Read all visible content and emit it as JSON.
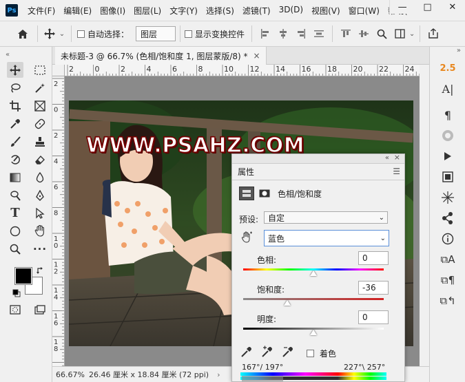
{
  "app": {
    "logo": "Ps"
  },
  "menu": [
    "文件(F)",
    "编辑(E)",
    "图像(I)",
    "图层(L)",
    "文字(Y)",
    "选择(S)",
    "滤镜(T)",
    "3D(D)",
    "视图(V)",
    "窗口(W)",
    "帮助("
  ],
  "window_controls": {
    "minimize": "—",
    "restore": "□",
    "close": "✕"
  },
  "options": {
    "auto_select_label": "自动选择：",
    "layer_dropdown": "图层",
    "show_transform_label": "显示变换控件"
  },
  "document": {
    "tab_title": "未标题-3 @ 66.7% (色相/饱和度 1, 图层蒙版/8) *",
    "tab_close": "×",
    "ruler_top": [
      "2",
      "0",
      "2",
      "4",
      "6",
      "8",
      "10",
      "12",
      "14",
      "16",
      "18",
      "20",
      "22",
      "24",
      "26"
    ],
    "ruler_left": [
      "2",
      "0",
      "2",
      "4",
      "6",
      "8",
      "1\n0",
      "1\n2",
      "1\n4",
      "1\n6",
      "1\n8"
    ],
    "watermark": "WWW.PSAHZ.COM"
  },
  "status": {
    "zoom": "66.67%",
    "size": "26.46 厘米 x 18.84 厘米 (72 ppi)"
  },
  "right_dock": {
    "value_label": "2.5"
  },
  "properties": {
    "title": "属性",
    "adjustment_name": "色相/饱和度",
    "preset_label": "预设:",
    "preset_value": "自定",
    "channel_value": "蓝色",
    "hue_label": "色相:",
    "hue_value": "0",
    "saturation_label": "饱和度:",
    "saturation_value": "-36",
    "lightness_label": "明度:",
    "lightness_value": "0",
    "colorize_label": "着色",
    "range_left": "167°/ 197°",
    "range_right": "227°\\ 257°"
  },
  "colors": {
    "accent_orange": "#e8871e",
    "foreground": "#000000",
    "background": "#ffffff"
  }
}
